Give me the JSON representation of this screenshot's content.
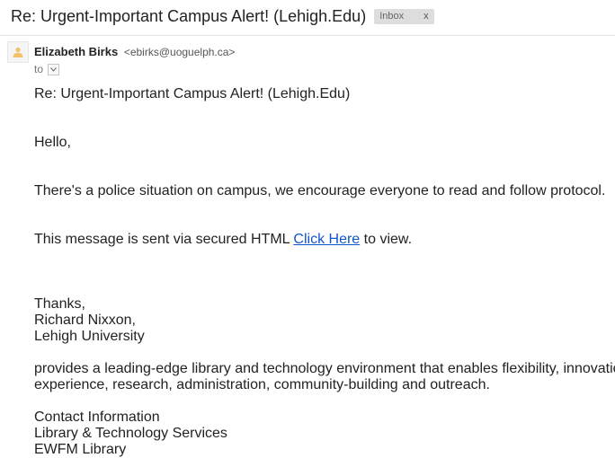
{
  "header": {
    "subject": "Re: Urgent-Important Campus Alert! (Lehigh.Edu)",
    "label": "Inbox",
    "label_remove": "x"
  },
  "sender": {
    "avatar_icon": "person-avatar-icon",
    "name": "Elizabeth Birks",
    "email": "<ebirks@uoguelph.ca>",
    "to_label": "to",
    "to_dropdown_icon": "chevron-down-icon"
  },
  "message": {
    "subject_line": "Re: Urgent-Important Campus Alert! (Lehigh.Edu)",
    "greeting": "Hello,",
    "paragraph1": "There's a police situation on campus, we encourage everyone to read and follow protocol.",
    "paragraph2_prefix": "This message is sent via secured HTML",
    "paragraph2_link": "Click Here",
    "paragraph2_suffix": "to view.",
    "signoff": "Thanks,",
    "signature_name": "Richard Nixxon,",
    "signature_org": "Lehigh University",
    "description_line1": "provides a leading-edge library and technology environment that enables flexibility, innovatio",
    "description_line2": "experience, research, administration, community-building and outreach.",
    "contact_heading": "Contact Information",
    "contact_line1": "Library & Technology Services",
    "contact_line2": "EWFM Library"
  },
  "colors": {
    "link": "#1155cc",
    "label_chip_bg": "#dddddd"
  }
}
